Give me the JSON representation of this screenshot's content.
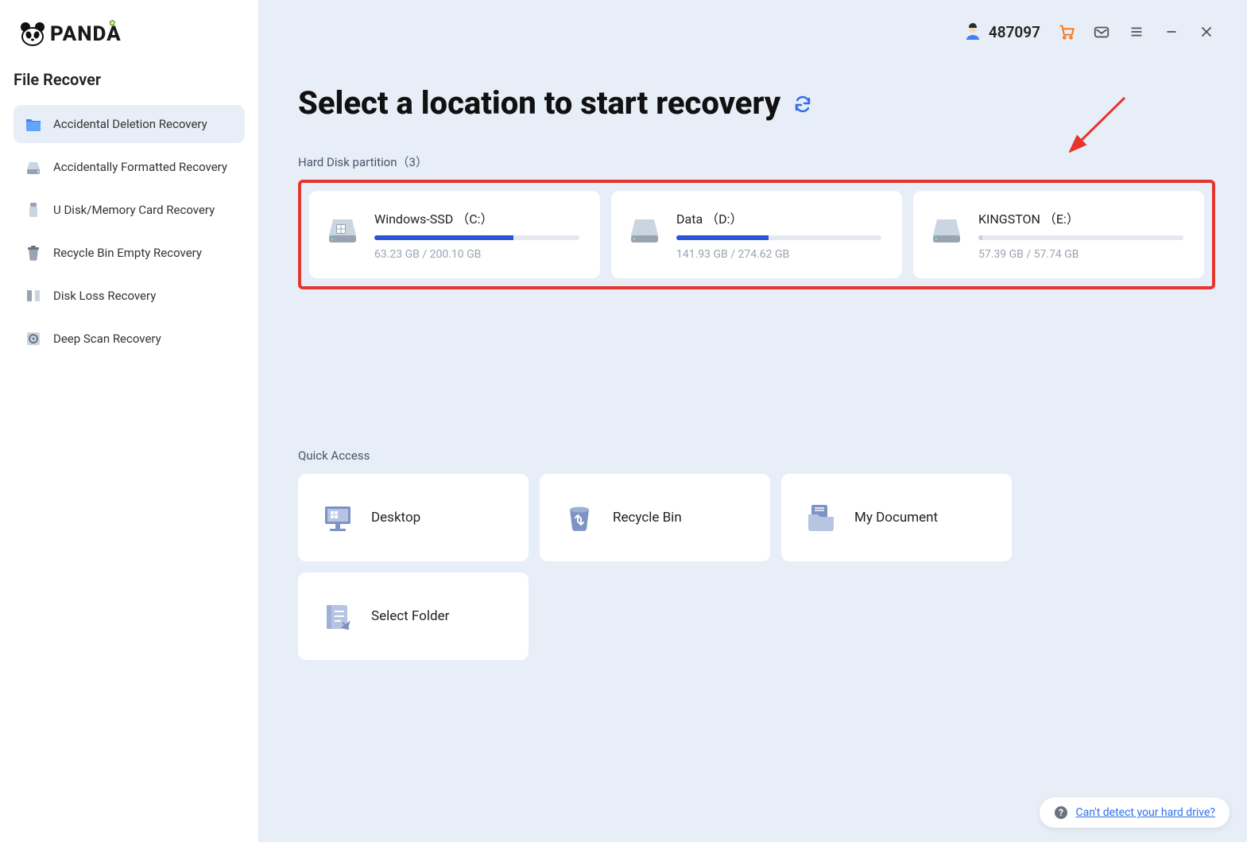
{
  "app_name": "PANDA",
  "sidebar": {
    "section_title": "File Recover",
    "items": [
      {
        "label": "Accidental Deletion Recovery",
        "active": true
      },
      {
        "label": "Accidentally Formatted Recovery",
        "active": false
      },
      {
        "label": "U Disk/Memory Card Recovery",
        "active": false
      },
      {
        "label": "Recycle Bin Empty Recovery",
        "active": false
      },
      {
        "label": "Disk Loss Recovery",
        "active": false
      },
      {
        "label": "Deep Scan Recovery",
        "active": false
      }
    ]
  },
  "topbar": {
    "user_id": "487097"
  },
  "page": {
    "title": "Select a location to start recovery"
  },
  "partitions": {
    "label": "Hard Disk partition",
    "count": "（3）",
    "items": [
      {
        "name": "Windows-SSD （C:）",
        "used_text": "63.23 GB / 200.10 GB",
        "fill_pct": 68,
        "color": "#2955d9"
      },
      {
        "name": "Data （D:）",
        "used_text": "141.93 GB / 274.62 GB",
        "fill_pct": 45,
        "color": "#2955d9"
      },
      {
        "name": "KINGSTON （E:）",
        "used_text": "57.39 GB / 57.74 GB",
        "fill_pct": 2,
        "color": "#c9d0de"
      }
    ]
  },
  "quick_access": {
    "label": "Quick Access",
    "items": [
      {
        "title": "Desktop"
      },
      {
        "title": "Recycle Bin"
      },
      {
        "title": "My Document"
      },
      {
        "title": "Select Folder"
      }
    ]
  },
  "help": {
    "text": "Can't detect your hard drive?"
  }
}
